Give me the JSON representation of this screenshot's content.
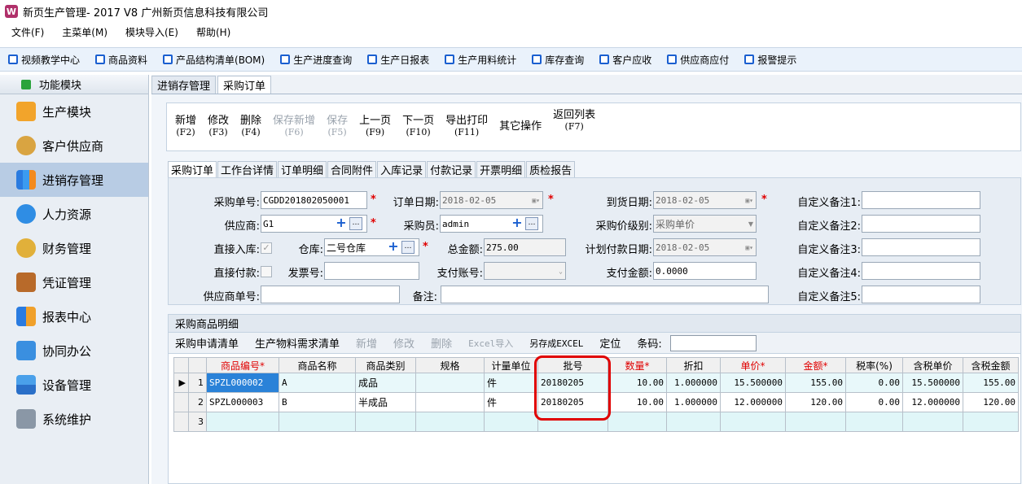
{
  "window": {
    "title": "新页生产管理- 2017 V8 广州新页信息科技有限公司",
    "icon": "W"
  },
  "menu": [
    "文件(F)",
    "主菜单(M)",
    "模块导入(E)",
    "帮助(H)"
  ],
  "quicklinks": [
    "视频教学中心",
    "商品资料",
    "产品结构清单(BOM)",
    "生产进度查询",
    "生产日报表",
    "生产用料统计",
    "库存查询",
    "客户应收",
    "供应商应付",
    "报警提示"
  ],
  "sidebar": {
    "header": "功能模块",
    "items": [
      "生产模块",
      "客户供应商",
      "进销存管理",
      "人力资源",
      "财务管理",
      "凭证管理",
      "报表中心",
      "协同办公",
      "设备管理",
      "系统维护"
    ]
  },
  "tabs": [
    "进销存管理",
    "采购订单"
  ],
  "actions": [
    {
      "label": "新增",
      "key": "(F2)"
    },
    {
      "label": "修改",
      "key": "(F3)"
    },
    {
      "label": "删除",
      "key": "(F4)"
    },
    {
      "label": "保存新增",
      "key": "(F6)"
    },
    {
      "label": "保存",
      "key": "(F5)"
    },
    {
      "label": "上一页",
      "key": "(F9)"
    },
    {
      "label": "下一页",
      "key": "(F10)"
    },
    {
      "label": "导出打印",
      "key": "(F11)"
    },
    {
      "label": "其它操作",
      "key": ""
    },
    {
      "label": "返回列表",
      "key": "(F7)"
    }
  ],
  "subtabs": [
    "采购订单",
    "工作台详情",
    "订单明细",
    "合同附件",
    "入库记录",
    "付款记录",
    "开票明细",
    "质检报告"
  ],
  "form": {
    "order_no_label": "采购单号:",
    "order_no": "CGDD201802050001",
    "order_date_label": "订单日期:",
    "order_date": "2018-02-05",
    "arrival_date_label": "到货日期:",
    "arrival_date": "2018-02-05",
    "supplier_label": "供应商:",
    "supplier": "G1",
    "buyer_label": "采购员:",
    "buyer": "admin",
    "price_level_label": "采购价级别:",
    "price_level": "采购单价",
    "direct_in_label": "直接入库:",
    "direct_in_mark": "✓",
    "warehouse_label": "仓库:",
    "warehouse": "二号仓库",
    "total_label": "总金额:",
    "total": "275.00",
    "plan_pay_label": "计划付款日期:",
    "plan_pay_date": "2018-02-05",
    "direct_pay_label": "直接付款:",
    "invoice_label": "发票号:",
    "pay_account_label": "支付账号:",
    "pay_amount_label": "支付金额:",
    "pay_amount": "0.0000",
    "supplier_doc_label": "供应商单号:",
    "remark_label": "备注:",
    "custom_labels": [
      "自定义备注1:",
      "自定义备注2:",
      "自定义备注3:",
      "自定义备注4:",
      "自定义备注5:"
    ]
  },
  "grid_panel": {
    "title": "采购商品明细",
    "tools": [
      "采购申请清单",
      "生产物料需求清单",
      "新增",
      "修改",
      "删除",
      "Excel导入",
      "另存成EXCEL",
      "定位"
    ],
    "code_label": "条码:"
  },
  "grid": {
    "columns": [
      "商品编号*",
      "商品名称",
      "商品类别",
      "规格",
      "计量单位",
      "批号",
      "数量*",
      "折扣",
      "单价*",
      "金额*",
      "税率(%)",
      "含税单价",
      "含税金额"
    ],
    "rows": [
      {
        "n": "1",
        "marker": "▶",
        "cells": [
          "SPZL000002",
          "A",
          "成品",
          "",
          "件",
          "20180205",
          "10.00",
          "1.000000",
          "15.500000",
          "155.00",
          "0.00",
          "15.500000",
          "155.00"
        ]
      },
      {
        "n": "2",
        "marker": "",
        "cells": [
          "SPZL000003",
          "B",
          "半成品",
          "",
          "件",
          "20180205",
          "10.00",
          "1.000000",
          "12.000000",
          "120.00",
          "0.00",
          "12.000000",
          "120.00"
        ]
      },
      {
        "n": "3",
        "marker": "",
        "cells": [
          "",
          "",
          "",
          "",
          "",
          "",
          "",
          "",
          "",
          "",
          "",
          "",
          ""
        ]
      }
    ]
  },
  "colors": {
    "accent": "#1a5fd0",
    "required": "#e00000",
    "selected_cell": "#2a82d8"
  }
}
